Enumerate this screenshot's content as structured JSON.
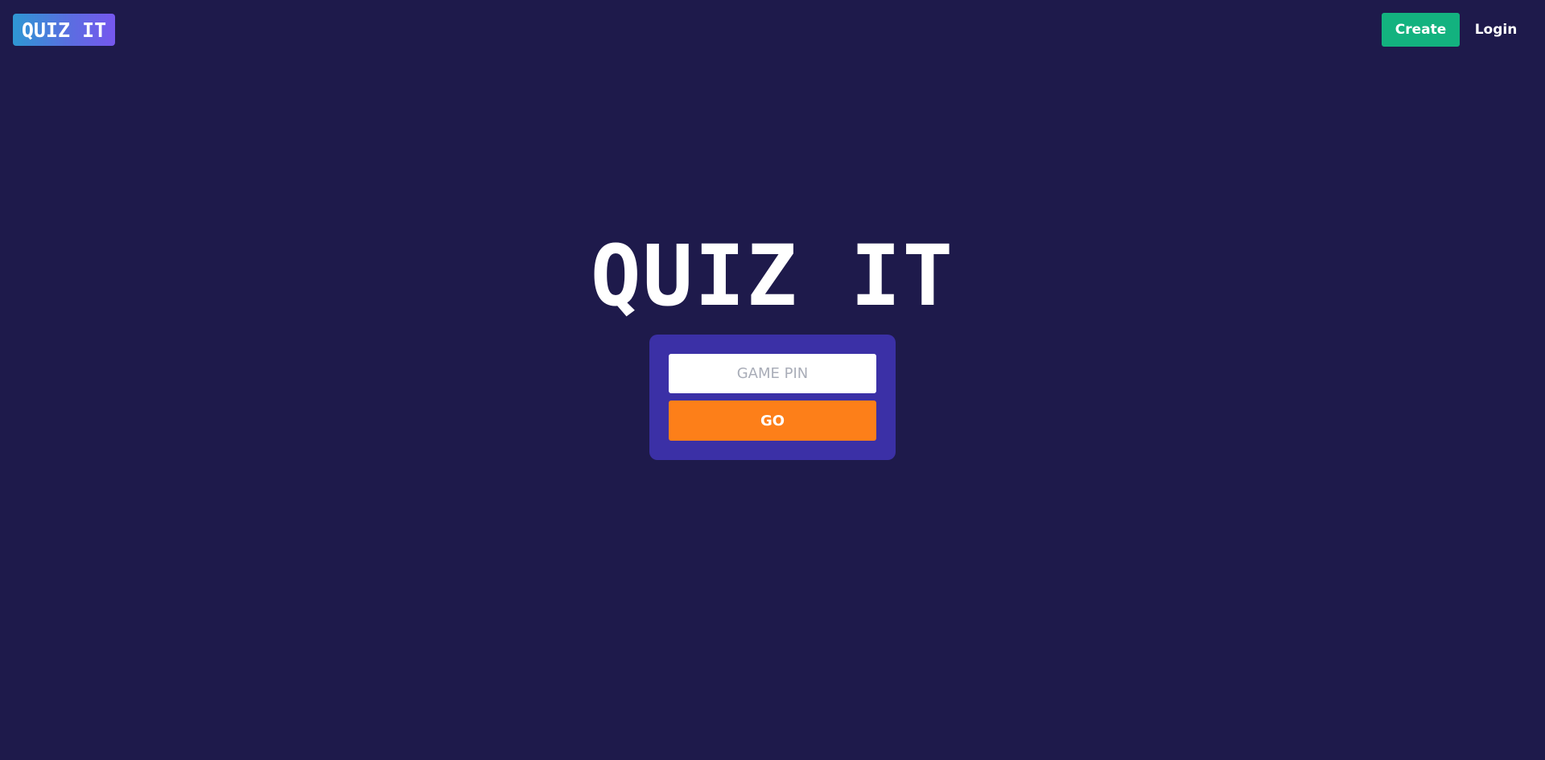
{
  "header": {
    "logo_text": "QUIZ IT",
    "create_label": "Create",
    "login_label": "Login"
  },
  "hero": {
    "title": "QUIZ IT"
  },
  "join": {
    "pin_placeholder": "GAME PIN",
    "pin_value": "",
    "go_label": "GO"
  },
  "colors": {
    "background": "#1e1a4b",
    "card": "#3b30a6",
    "create_button": "#13b27f",
    "go_button": "#fd7f19",
    "logo_gradient_start": "#2e97d3",
    "logo_gradient_end": "#7657ee"
  }
}
